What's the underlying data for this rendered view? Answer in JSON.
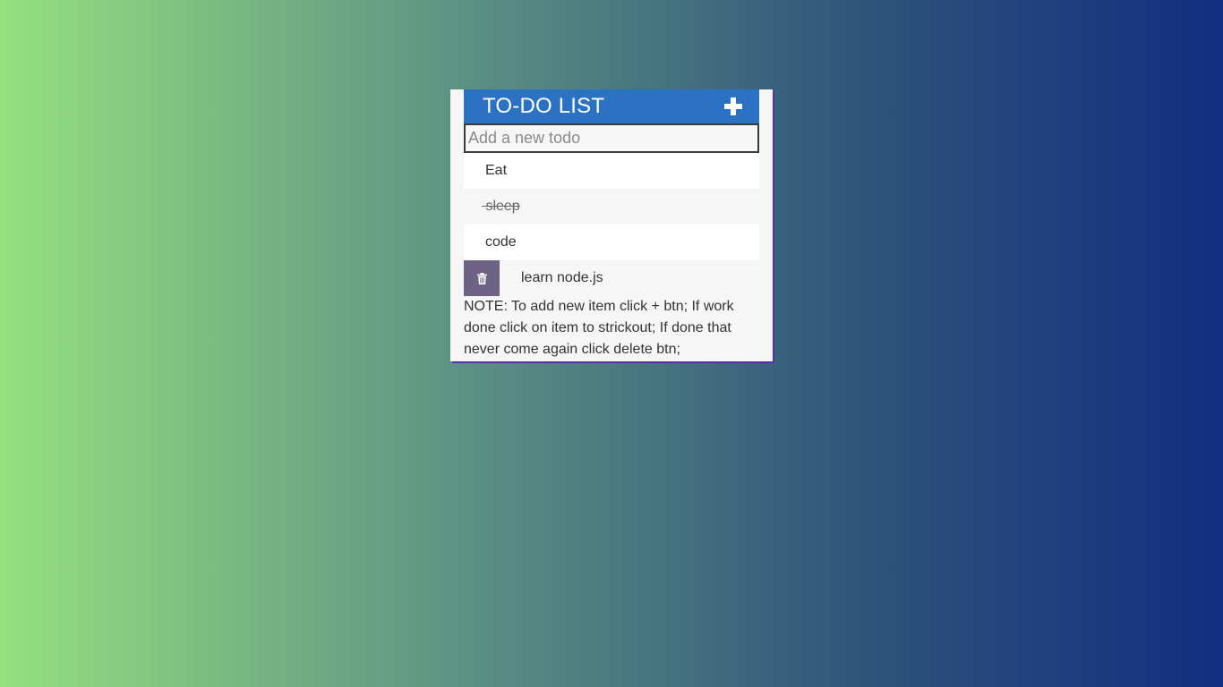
{
  "header": {
    "title": "TO-DO LIST",
    "add_icon": "plus-icon"
  },
  "input": {
    "placeholder": "Add a new todo",
    "value": ""
  },
  "todos": [
    {
      "text": "Eat",
      "done": false
    },
    {
      "text": "sleep",
      "done": true
    },
    {
      "text": "code",
      "done": false
    },
    {
      "text": "learn node.js",
      "done": false,
      "delete_visible": true,
      "delete_icon": "trash-icon"
    }
  ],
  "note": "NOTE: To add new item click + btn; If work done click on item to strickout; If done that never come again click delete btn;",
  "colors": {
    "header": "#2c72c3",
    "delete_button": "#6e6387",
    "container": "#f6f6f6",
    "gradient_start": "#95e07f",
    "gradient_end": "#132d81"
  }
}
